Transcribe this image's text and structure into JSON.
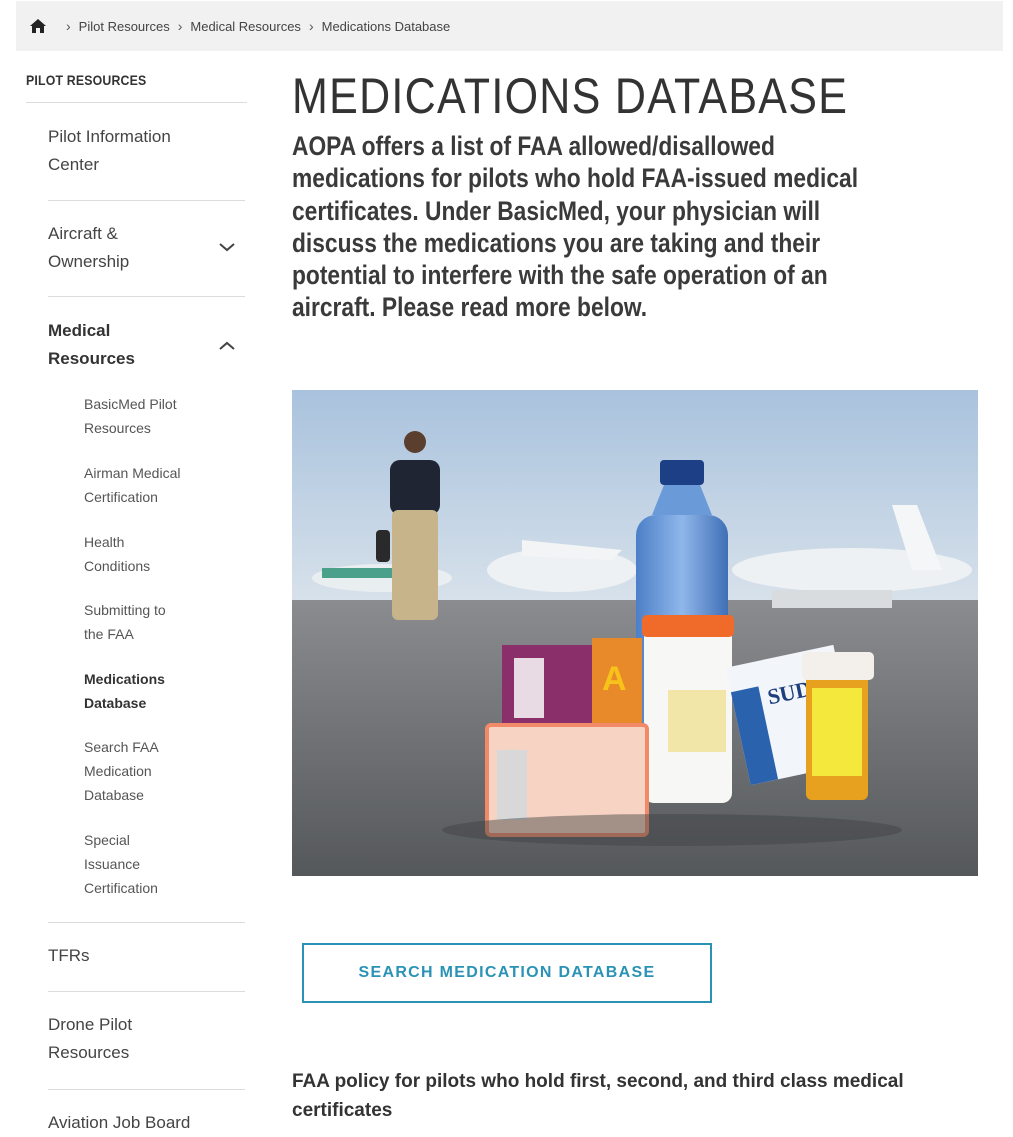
{
  "breadcrumb": {
    "home_icon": "home-icon",
    "items": [
      "Pilot Resources",
      "Medical Resources",
      "Medications Database"
    ],
    "separator": "›"
  },
  "sidebar": {
    "heading": "PILOT RESOURCES",
    "items": [
      {
        "label_line1": "Pilot Information",
        "label_line2": "Center"
      },
      {
        "label_line1": "Aircraft &",
        "label_line2": "Ownership",
        "icon": "chevron-down-icon"
      },
      {
        "label_line1": "Medical",
        "label_line2": "Resources",
        "icon": "chevron-up-icon"
      },
      {
        "label_line1": "TFRs"
      },
      {
        "label_line1": "Drone Pilot",
        "label_line2": "Resources"
      },
      {
        "label_line1": "Aviation Job Board"
      }
    ],
    "sub_items": [
      {
        "l1": "BasicMed Pilot",
        "l2": "Resources"
      },
      {
        "l1": "Airman Medical",
        "l2": "Certification"
      },
      {
        "l1": "Health",
        "l2": "Conditions"
      },
      {
        "l1": "Submitting to",
        "l2": "the FAA"
      },
      {
        "l1": "Medications",
        "l2": "Database"
      },
      {
        "l1": "Search FAA",
        "l2": "Medication",
        "l3": "Database"
      },
      {
        "l1": "Special",
        "l2": "Issuance",
        "l3": "Certification"
      }
    ]
  },
  "main": {
    "title": "MEDICATIONS DATABASE",
    "intro_lines": [
      "AOPA offers a list of FAA allowed/disallowed",
      "medications for pilots who hold FAA-issued medical",
      "certificates. Under BasicMed, your physician will",
      "discuss the medications you are taking and their",
      "potential to interfere with the safe operation of an",
      "aircraft. Please read more below."
    ],
    "cta_label": "SEARCH MEDICATION DATABASE",
    "policy_line1": "FAA policy for pilots who hold first, second, and third class medical",
    "policy_line2": "certificates"
  },
  "colors": {
    "accent": "#2a93b5",
    "breadcrumb_bg": "#f1f1f1",
    "text": "#333333"
  }
}
